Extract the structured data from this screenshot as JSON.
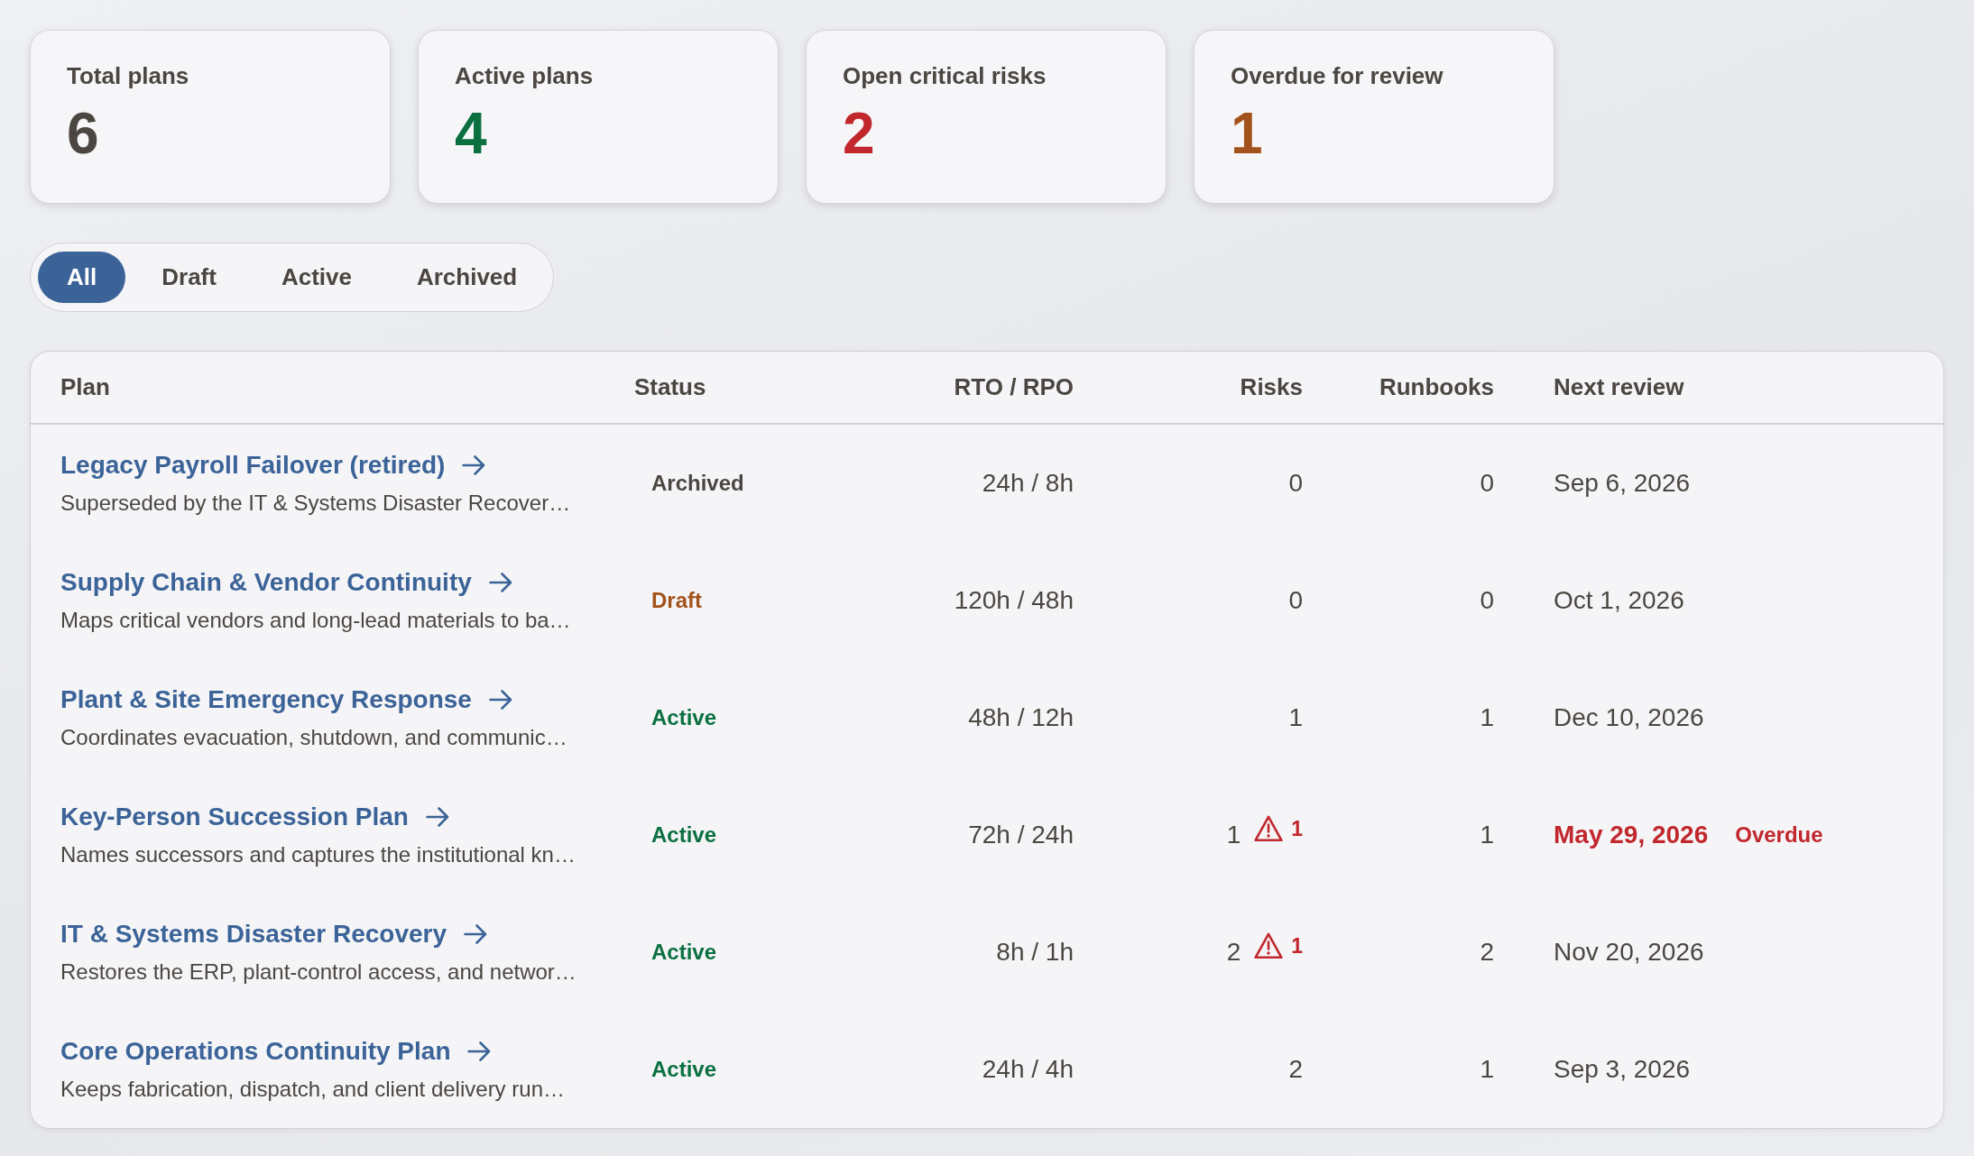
{
  "stats": [
    {
      "label": "Total plans",
      "value": "6",
      "color": "#4b4641"
    },
    {
      "label": "Active plans",
      "value": "4",
      "color": "#0b7040"
    },
    {
      "label": "Open critical risks",
      "value": "2",
      "color": "#c1272d"
    },
    {
      "label": "Overdue for review",
      "value": "1",
      "color": "#a3521b"
    }
  ],
  "filters": [
    {
      "label": "All",
      "selected": true
    },
    {
      "label": "Draft",
      "selected": false
    },
    {
      "label": "Active",
      "selected": false
    },
    {
      "label": "Archived",
      "selected": false
    }
  ],
  "table": {
    "columns": [
      "Plan",
      "Status",
      "RTO / RPO",
      "Risks",
      "Runbooks",
      "Next review"
    ],
    "rows": [
      {
        "title": "Legacy Payroll Failover (retired)",
        "description": "Superseded by the IT & Systems Disaster Recover…",
        "status": {
          "label": "Archived",
          "kind": "archived"
        },
        "rto_rpo": "24h / 8h",
        "risks": "0",
        "runbooks": "0",
        "next_review": "Sep 6, 2026",
        "overdue": false
      },
      {
        "title": "Supply Chain & Vendor Continuity",
        "description": "Maps critical vendors and long-lead materials to ba…",
        "status": {
          "label": "Draft",
          "kind": "draft"
        },
        "rto_rpo": "120h / 48h",
        "risks": "0",
        "runbooks": "0",
        "next_review": "Oct 1, 2026",
        "overdue": false
      },
      {
        "title": "Plant & Site Emergency Response",
        "description": "Coordinates evacuation, shutdown, and communic…",
        "status": {
          "label": "Active",
          "kind": "active"
        },
        "rto_rpo": "48h / 12h",
        "risks": "1",
        "runbooks": "1",
        "next_review": "Dec 10, 2026",
        "overdue": false
      },
      {
        "title": "Key-Person Succession Plan",
        "description": "Names successors and captures the institutional kn…",
        "status": {
          "label": "Active",
          "kind": "active"
        },
        "rto_rpo": "72h / 24h",
        "risks": "1",
        "critical_risks": "1",
        "runbooks": "1",
        "next_review": "May 29, 2026",
        "overdue": true,
        "overdue_label": "Overdue"
      },
      {
        "title": "IT & Systems Disaster Recovery",
        "description": "Restores the ERP, plant-control access, and networ…",
        "status": {
          "label": "Active",
          "kind": "active"
        },
        "rto_rpo": "8h / 1h",
        "risks": "2",
        "critical_risks": "1",
        "runbooks": "2",
        "next_review": "Nov 20, 2026",
        "overdue": false
      },
      {
        "title": "Core Operations Continuity Plan",
        "description": "Keeps fabrication, dispatch, and client delivery run…",
        "status": {
          "label": "Active",
          "kind": "active"
        },
        "rto_rpo": "24h / 4h",
        "risks": "2",
        "runbooks": "1",
        "next_review": "Sep 3, 2026",
        "overdue": false
      }
    ]
  }
}
